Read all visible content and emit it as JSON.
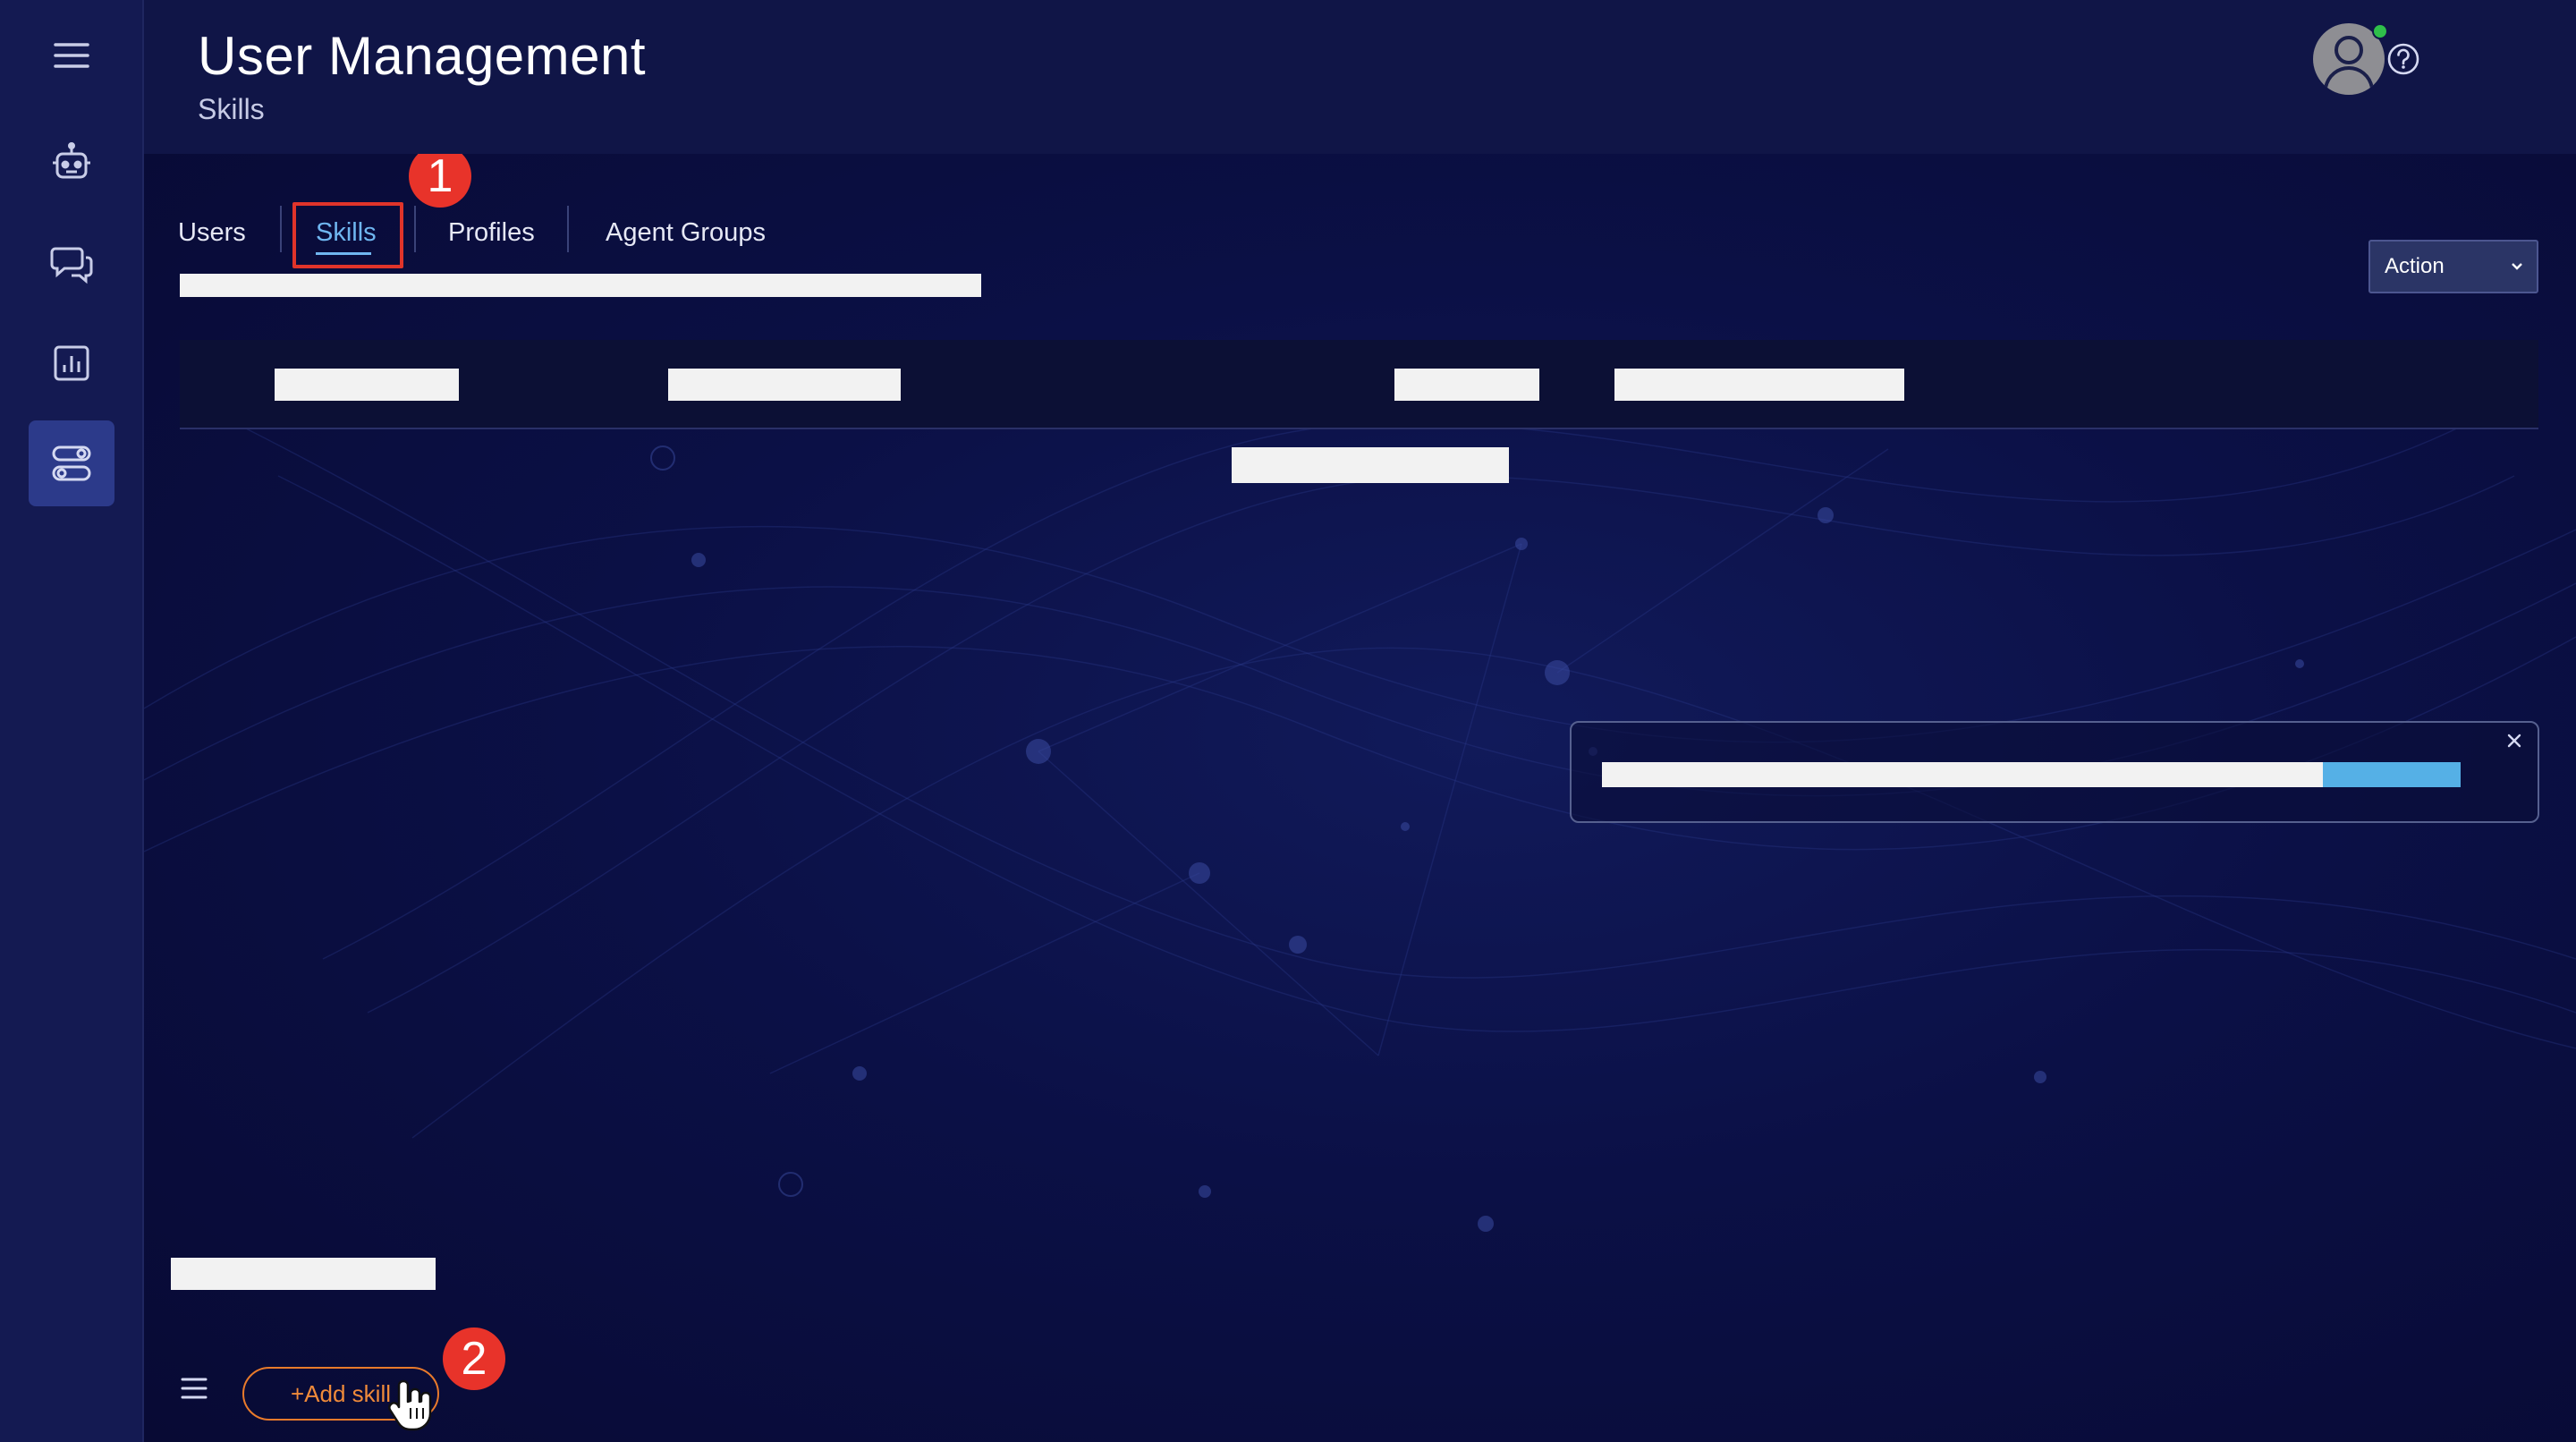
{
  "header": {
    "title": "User Management",
    "subtitle": "Skills"
  },
  "sidebar": {
    "items": [
      {
        "icon": "menu-icon"
      },
      {
        "icon": "robot-icon"
      },
      {
        "icon": "chat-icon"
      },
      {
        "icon": "analytics-icon"
      },
      {
        "icon": "settings-toggles-icon",
        "active": true
      }
    ]
  },
  "tabs": [
    {
      "label": "Users"
    },
    {
      "label": "Skills",
      "active": true
    },
    {
      "label": "Profiles"
    },
    {
      "label": "Agent Groups"
    }
  ],
  "markers": [
    "1",
    "2"
  ],
  "action_select": {
    "label": "Action"
  },
  "footer": {
    "add_skill_label": "+Add skill"
  },
  "colors": {
    "accent": "#6fb6f0",
    "highlight": "#e0342a",
    "add_button": "#ef8a3a",
    "sidebar_active": "#2c3a8a"
  }
}
